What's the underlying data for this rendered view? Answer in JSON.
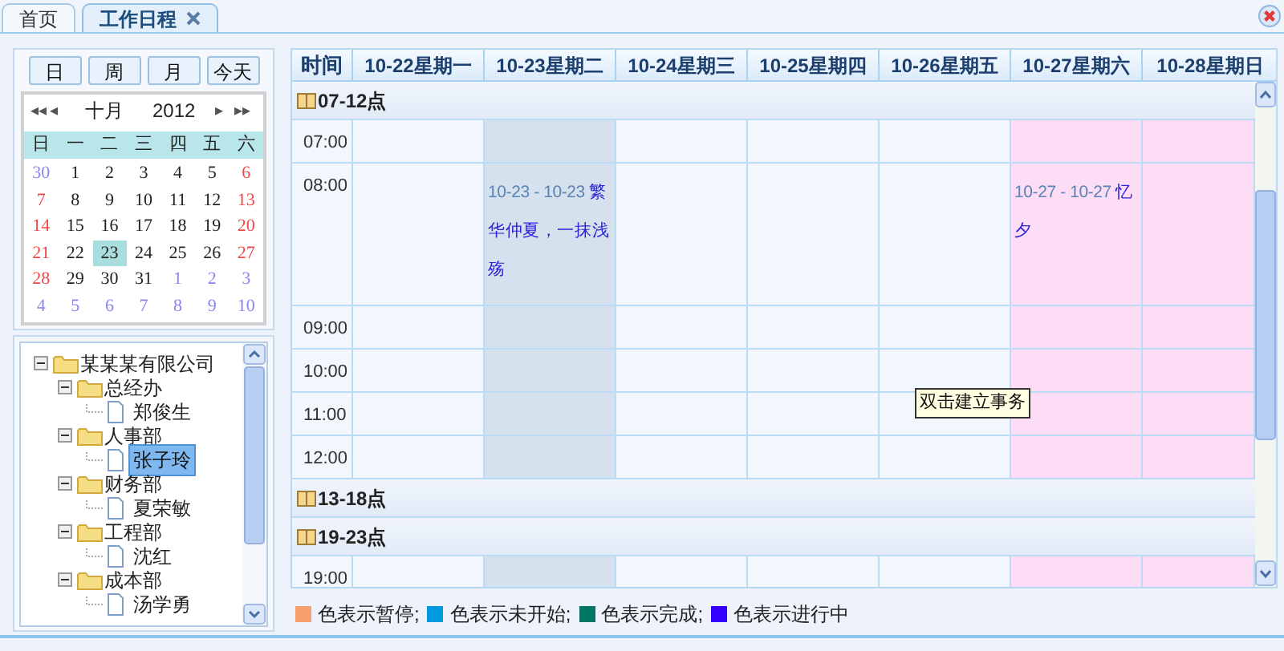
{
  "tabs": [
    {
      "label": "首页",
      "selected": false,
      "closable": false
    },
    {
      "label": "工作日程",
      "selected": true,
      "closable": true
    }
  ],
  "view_buttons": [
    "日",
    "周",
    "月",
    "今天"
  ],
  "mini_calendar": {
    "first": "◂◂",
    "prev": "◂",
    "month": "十月",
    "year": "2012",
    "next": "▸",
    "last": "▸▸",
    "weekdays": [
      "日",
      "一",
      "二",
      "三",
      "四",
      "五",
      "六"
    ],
    "weeks": [
      [
        {
          "d": "30",
          "kind": "other_month",
          "selected": false
        },
        {
          "d": "1",
          "kind": "weekday",
          "selected": false
        },
        {
          "d": "2",
          "kind": "weekday",
          "selected": false
        },
        {
          "d": "3",
          "kind": "weekday",
          "selected": false
        },
        {
          "d": "4",
          "kind": "weekday",
          "selected": false
        },
        {
          "d": "5",
          "kind": "weekday",
          "selected": false
        },
        {
          "d": "6",
          "kind": "weekend",
          "selected": false
        }
      ],
      [
        {
          "d": "7",
          "kind": "weekend",
          "selected": false
        },
        {
          "d": "8",
          "kind": "weekday",
          "selected": false
        },
        {
          "d": "9",
          "kind": "weekday",
          "selected": false
        },
        {
          "d": "10",
          "kind": "weekday",
          "selected": false
        },
        {
          "d": "11",
          "kind": "weekday",
          "selected": false
        },
        {
          "d": "12",
          "kind": "weekday",
          "selected": false
        },
        {
          "d": "13",
          "kind": "weekend",
          "selected": false
        }
      ],
      [
        {
          "d": "14",
          "kind": "weekend",
          "selected": false
        },
        {
          "d": "15",
          "kind": "weekday",
          "selected": false
        },
        {
          "d": "16",
          "kind": "weekday",
          "selected": false
        },
        {
          "d": "17",
          "kind": "weekday",
          "selected": false
        },
        {
          "d": "18",
          "kind": "weekday",
          "selected": false
        },
        {
          "d": "19",
          "kind": "weekday",
          "selected": false
        },
        {
          "d": "20",
          "kind": "weekend",
          "selected": false
        }
      ],
      [
        {
          "d": "21",
          "kind": "weekend",
          "selected": false
        },
        {
          "d": "22",
          "kind": "weekday",
          "selected": false
        },
        {
          "d": "23",
          "kind": "weekday",
          "selected": true
        },
        {
          "d": "24",
          "kind": "weekday",
          "selected": false
        },
        {
          "d": "25",
          "kind": "weekday",
          "selected": false
        },
        {
          "d": "26",
          "kind": "weekday",
          "selected": false
        },
        {
          "d": "27",
          "kind": "weekend",
          "selected": false
        }
      ],
      [
        {
          "d": "28",
          "kind": "weekend",
          "selected": false
        },
        {
          "d": "29",
          "kind": "weekday",
          "selected": false
        },
        {
          "d": "30",
          "kind": "weekday",
          "selected": false
        },
        {
          "d": "31",
          "kind": "weekday",
          "selected": false
        },
        {
          "d": "1",
          "kind": "other_month",
          "selected": false
        },
        {
          "d": "2",
          "kind": "other_month",
          "selected": false
        },
        {
          "d": "3",
          "kind": "other_month",
          "selected": false
        }
      ],
      [
        {
          "d": "4",
          "kind": "other_month",
          "selected": false
        },
        {
          "d": "5",
          "kind": "other_month",
          "selected": false
        },
        {
          "d": "6",
          "kind": "other_month",
          "selected": false
        },
        {
          "d": "7",
          "kind": "other_month",
          "selected": false
        },
        {
          "d": "8",
          "kind": "other_month",
          "selected": false
        },
        {
          "d": "9",
          "kind": "other_month",
          "selected": false
        },
        {
          "d": "10",
          "kind": "other_month",
          "selected": false
        }
      ]
    ]
  },
  "tree": {
    "label": "某某某有限公司",
    "expanded": true,
    "children": [
      {
        "label": "总经办",
        "expanded": true,
        "children": [
          {
            "label": "郑俊生",
            "selected": false
          }
        ]
      },
      {
        "label": "人事部",
        "expanded": true,
        "children": [
          {
            "label": "张子玲",
            "selected": true
          }
        ]
      },
      {
        "label": "财务部",
        "expanded": true,
        "children": [
          {
            "label": "夏荣敏",
            "selected": false
          }
        ]
      },
      {
        "label": "工程部",
        "expanded": true,
        "children": [
          {
            "label": "沈红",
            "selected": false
          }
        ]
      },
      {
        "label": "成本部",
        "expanded": true,
        "children": [
          {
            "label": "汤学勇",
            "selected": false
          }
        ]
      }
    ]
  },
  "schedule": {
    "time_header": "时间",
    "days": [
      {
        "label": "10-22星期一",
        "kind": "normal"
      },
      {
        "label": "10-23星期二",
        "kind": "current",
        "events": [
          {
            "range": "10-23 - 10-23",
            "title": "繁华仲夏，一抹浅殇"
          }
        ]
      },
      {
        "label": "10-24星期三",
        "kind": "normal"
      },
      {
        "label": "10-25星期四",
        "kind": "normal"
      },
      {
        "label": "10-26星期五",
        "kind": "normal"
      },
      {
        "label": "10-27星期六",
        "kind": "weekend",
        "events": [
          {
            "range": "10-27 - 10-27",
            "title": "忆夕"
          }
        ]
      },
      {
        "label": "10-28星期日",
        "kind": "weekend"
      }
    ],
    "sections": [
      {
        "label": "07-12点",
        "hours": [
          {
            "time": "07:00",
            "has_events": false
          },
          {
            "time": "08:00",
            "has_events": true
          },
          {
            "time": "09:00",
            "has_events": false
          },
          {
            "time": "10:00",
            "has_events": false
          },
          {
            "time": "11:00",
            "has_events": false
          },
          {
            "time": "12:00",
            "has_events": false
          }
        ]
      },
      {
        "label": "13-18点"
      },
      {
        "label": "19-23点",
        "hours": [
          {
            "time": "19:00",
            "has_events": false
          }
        ]
      }
    ],
    "tooltip": "双击建立事务"
  },
  "legend": [
    {
      "color": "#f8a070",
      "label": "色表示暂停;"
    },
    {
      "color": "#0099dd",
      "label": "色表示未开始;"
    },
    {
      "color": "#007766",
      "label": "色表示完成;"
    },
    {
      "color": "#3300ff",
      "label": "色表示进行中"
    }
  ]
}
